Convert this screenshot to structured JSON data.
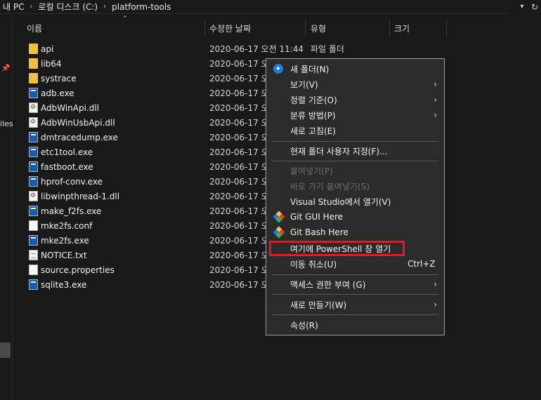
{
  "breadcrumb": [
    "내 PC",
    "로컬 디스크 (C:)",
    "platform-tools"
  ],
  "left_fragment": "iles",
  "columns": [
    "이름",
    "수정한 날짜",
    "유형",
    "크기"
  ],
  "files": [
    {
      "name": "api",
      "date": "2020-06-17 오전 11:44",
      "type": "파일 폴더",
      "icon": "folder-icon"
    },
    {
      "name": "lib64",
      "date": "2020-06-17 오",
      "type": "",
      "icon": "folder-icon"
    },
    {
      "name": "systrace",
      "date": "2020-06-17 오",
      "type": "",
      "icon": "folder-icon"
    },
    {
      "name": "adb.exe",
      "date": "2020-06-17 오",
      "type": "",
      "icon": "exe-icon"
    },
    {
      "name": "AdbWinApi.dll",
      "date": "2020-06-17 오",
      "type": "",
      "icon": "dll-icon"
    },
    {
      "name": "AdbWinUsbApi.dll",
      "date": "2020-06-17 오",
      "type": "",
      "icon": "dll-icon"
    },
    {
      "name": "dmtracedump.exe",
      "date": "2020-06-17 오",
      "type": "",
      "icon": "exe-icon"
    },
    {
      "name": "etc1tool.exe",
      "date": "2020-06-17 오",
      "type": "",
      "icon": "exe-icon"
    },
    {
      "name": "fastboot.exe",
      "date": "2020-06-17 오",
      "type": "",
      "icon": "exe-icon"
    },
    {
      "name": "hprof-conv.exe",
      "date": "2020-06-17 오",
      "type": "",
      "icon": "exe-icon"
    },
    {
      "name": "libwinpthread-1.dll",
      "date": "2020-06-17 오",
      "type": "",
      "icon": "dll-icon"
    },
    {
      "name": "make_f2fs.exe",
      "date": "2020-06-17 오",
      "type": "",
      "icon": "exe-icon"
    },
    {
      "name": "mke2fs.conf",
      "date": "2020-06-17 오",
      "type": "",
      "icon": "file-icon"
    },
    {
      "name": "mke2fs.exe",
      "date": "2020-06-17 오",
      "type": "",
      "icon": "exe-icon"
    },
    {
      "name": "NOTICE.txt",
      "date": "2020-06-17 오",
      "type": "",
      "icon": "text-file-icon"
    },
    {
      "name": "source.properties",
      "date": "2020-06-17 오",
      "type": "",
      "icon": "file-icon"
    },
    {
      "name": "sqlite3.exe",
      "date": "2020-06-17 오",
      "type": "",
      "icon": "exe-icon"
    }
  ],
  "context_menu": [
    {
      "label": "새 폴더(N)"
    },
    {
      "label": "보기(V)"
    },
    {
      "label": "정렬 기준(O)"
    },
    {
      "label": "분류 방법(P)"
    },
    {
      "label": "새로 고침(E)"
    },
    {
      "label": "현재 폴더 사용자 지정(F)..."
    },
    {
      "label": "붙여넣기(P)"
    },
    {
      "label": "바로 가기 붙여넣기(S)"
    },
    {
      "label": "Visual Studio에서 열기(V)"
    },
    {
      "label": "Git GUI Here"
    },
    {
      "label": "Git Bash Here"
    },
    {
      "label": "여기에 PowerShell 창 열기"
    },
    {
      "label": "이동 취소(U)",
      "shortcut": "Ctrl+Z"
    },
    {
      "label": "액세스 권한 부여 (G)"
    },
    {
      "label": "새로 만들기(W)"
    },
    {
      "label": "속성(R)"
    }
  ],
  "highlight_color": "#e3192a",
  "accent_color": "#1d7ad8"
}
